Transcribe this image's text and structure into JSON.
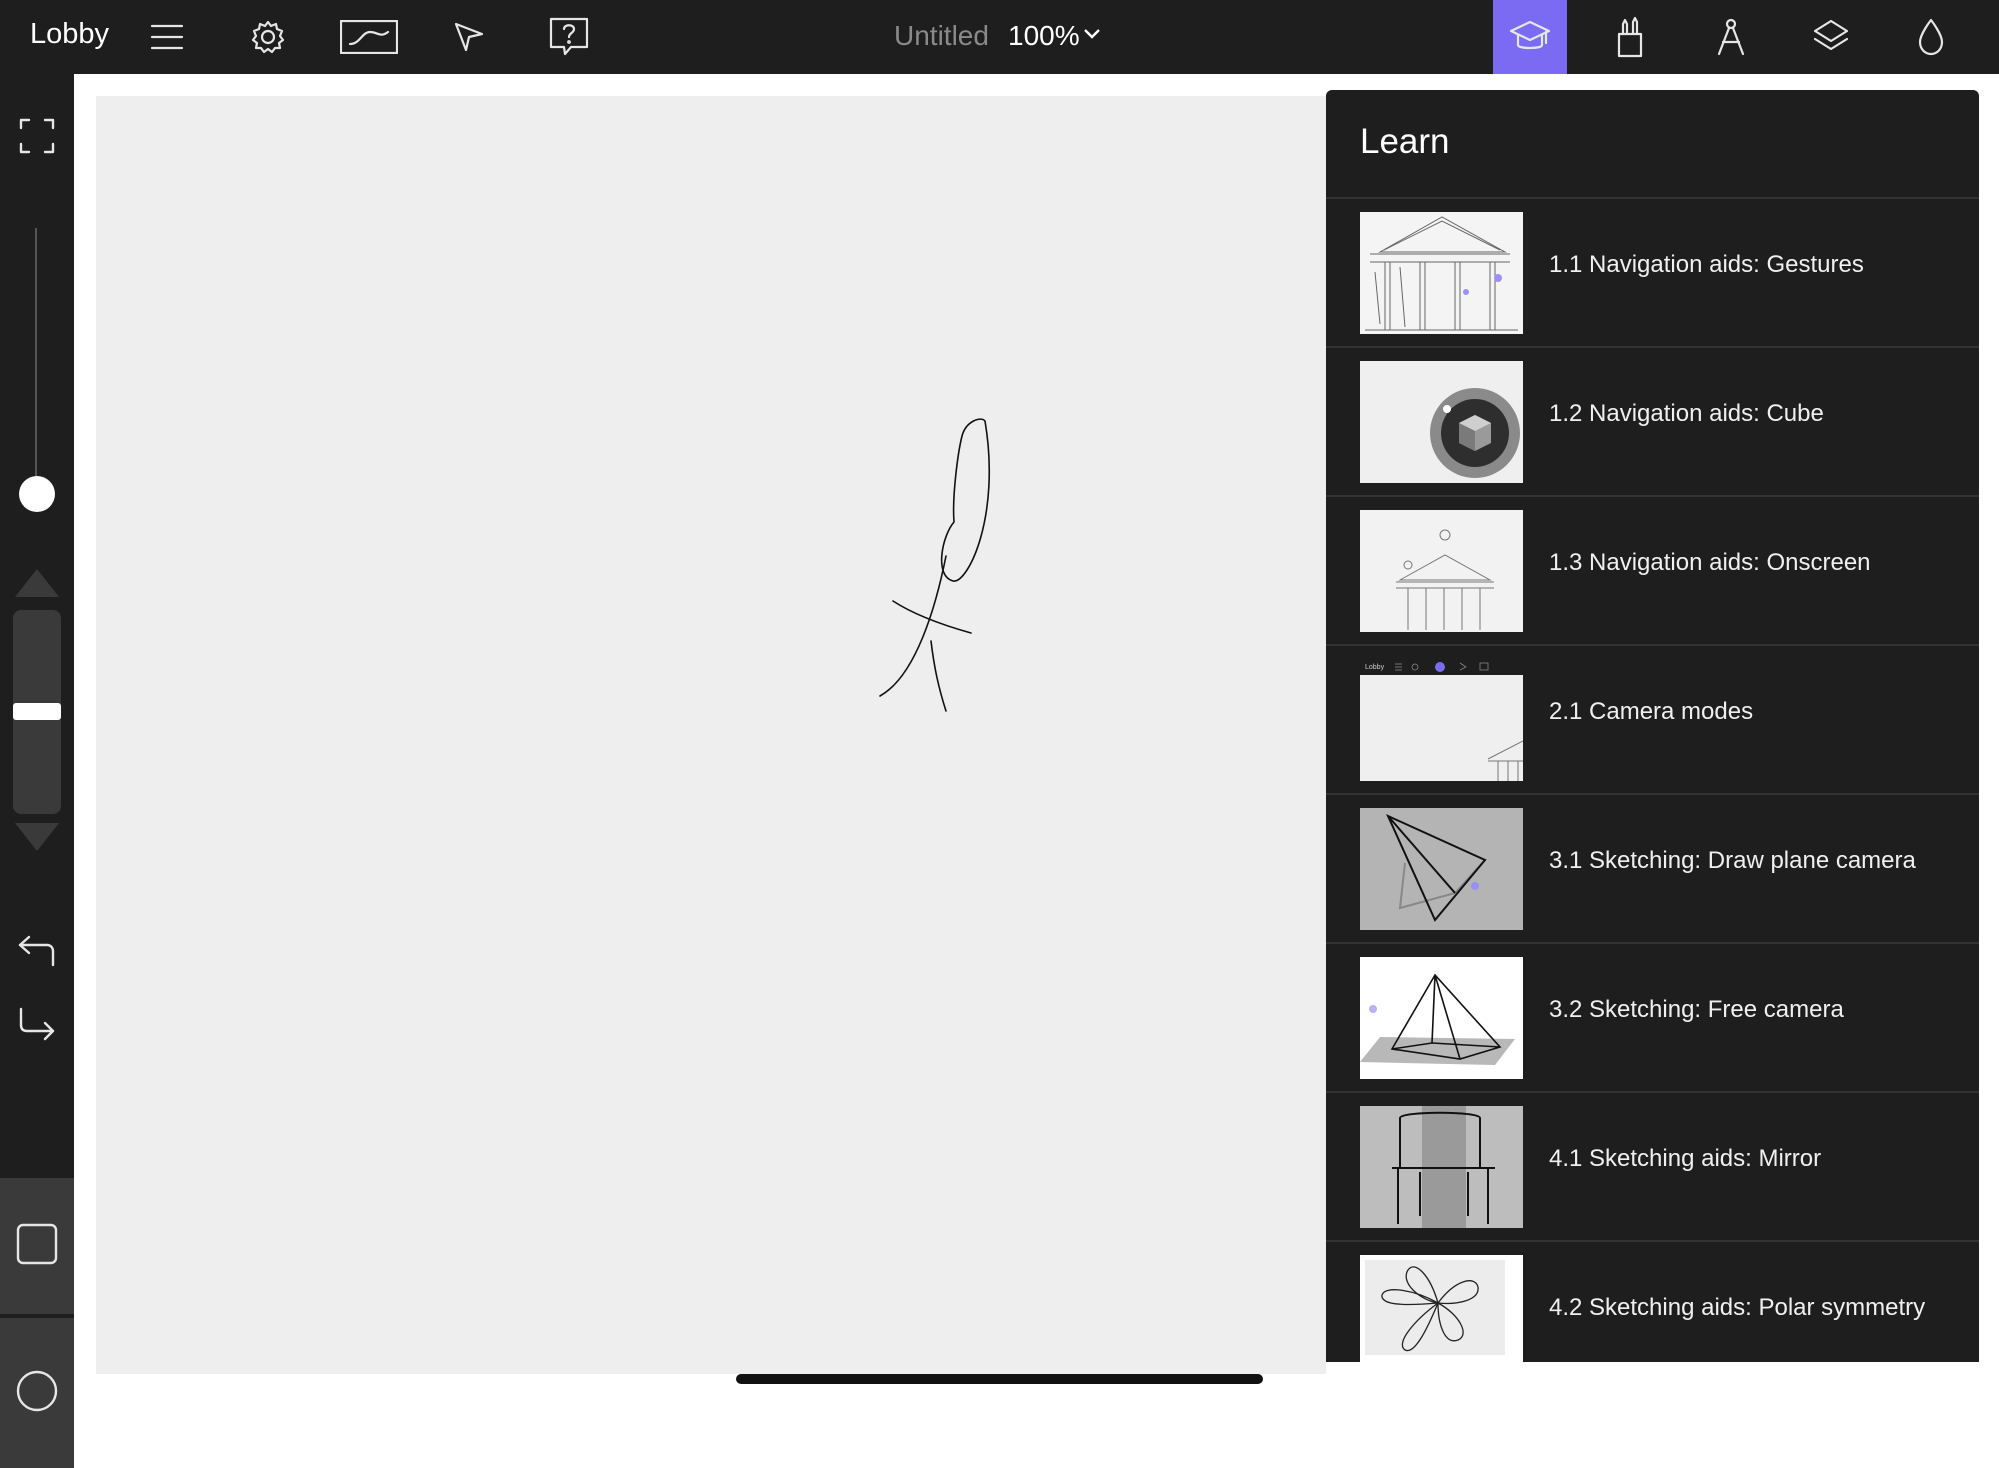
{
  "topbar": {
    "lobby_label": "Lobby",
    "doc_title": "Untitled",
    "zoom": "100%",
    "icons": [
      "menu-icon",
      "gear-icon",
      "stroke-icon",
      "cursor-icon",
      "help-icon",
      "learn-cap-icon",
      "brushes-icon",
      "compass-icon",
      "layers-icon",
      "color-drop-icon"
    ],
    "active_tab": "learn",
    "accent_color": "#7b6bf2"
  },
  "leftbar": {
    "icons": [
      "fullscreen-icon",
      "undo-icon",
      "redo-icon",
      "square-shape-icon",
      "circle-shape-icon"
    ]
  },
  "learn": {
    "title": "Learn",
    "lessons": [
      {
        "label": "1.1 Navigation aids: Gestures"
      },
      {
        "label": "1.2 Navigation aids: Cube"
      },
      {
        "label": "1.3 Navigation aids: Onscreen"
      },
      {
        "label": "2.1 Camera modes"
      },
      {
        "label": "3.1 Sketching: Draw plane camera"
      },
      {
        "label": "3.2 Sketching: Free camera"
      },
      {
        "label": "4.1 Sketching aids: Mirror"
      },
      {
        "label": "4.2 Sketching aids: Polar symmetry"
      }
    ],
    "thumb2_1": {
      "mini_lobby": "Lobby"
    }
  }
}
